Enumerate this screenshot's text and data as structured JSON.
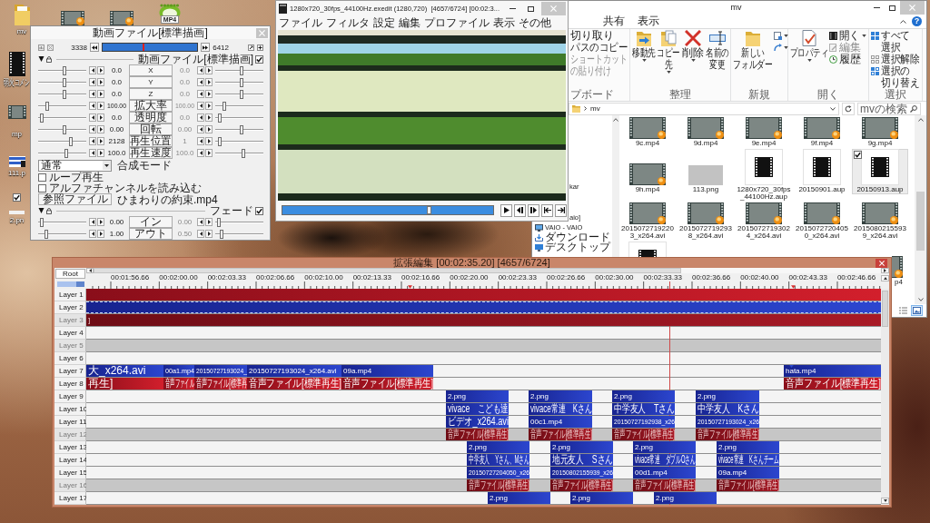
{
  "desktop": {
    "icons": [
      {
        "kind": "folder",
        "label": "mv",
        "selected": false
      },
      {
        "kind": "video",
        "selected": false
      },
      {
        "kind": "video",
        "selected": false
      },
      {
        "kind": "mp4",
        "badge": "MP4",
        "selected": false
      },
      {
        "kind": "film",
        "label": "弱火コメン",
        "selected": false
      },
      {
        "kind": "clip",
        "label": "mp",
        "selected": false
      },
      {
        "kind": "image",
        "label": "111.p",
        "selected": false
      },
      {
        "kind": "blank",
        "label": "2.pn",
        "selected": true
      }
    ]
  },
  "object_dialog": {
    "title": "動画ファイル[標準描画]",
    "frame_range": {
      "start": "3338",
      "end": "6412",
      "level": 0.43
    },
    "object": {
      "label": "動画ファイル[標準描画]",
      "expanded": true,
      "checked": true
    },
    "params": [
      {
        "name": "X",
        "start": {
          "value": "0.0",
          "level": 0.55
        },
        "end": {
          "value": "0.0",
          "disabled": true,
          "level": 0.55
        }
      },
      {
        "name": "Y",
        "start": {
          "value": "0.0",
          "level": 0.55
        },
        "end": {
          "value": "0.0",
          "disabled": true,
          "level": 0.55
        }
      },
      {
        "name": "Z",
        "start": {
          "value": "0.0",
          "level": 0.55
        },
        "end": {
          "value": "0.0",
          "disabled": true,
          "level": 0.55
        }
      },
      {
        "name": "拡大率",
        "start": {
          "value": "100.00",
          "level": 0.17
        },
        "end": {
          "value": "100.00",
          "disabled": true,
          "level": 0.16
        }
      },
      {
        "name": "透明度",
        "start": {
          "value": "0.0",
          "level": 0.04
        },
        "end": {
          "value": "0.0",
          "disabled": true,
          "level": 0.06
        }
      },
      {
        "name": "回転",
        "start": {
          "value": "0.00",
          "level": 0.55
        },
        "end": {
          "value": "0.00",
          "disabled": true,
          "level": 0.55
        }
      },
      {
        "name": "再生位置",
        "start": {
          "value": "2128",
          "level": 0.7
        },
        "end": {
          "value": "1",
          "disabled": true,
          "level": 0.06
        }
      },
      {
        "name": "再生速度",
        "start": {
          "value": "100.0",
          "level": 0.6
        },
        "end": {
          "value": "100.0",
          "disabled": true,
          "level": 0.6
        }
      }
    ],
    "blend_mode": {
      "value": "通常",
      "label": "合成モード"
    },
    "options": [
      {
        "label": "ループ再生",
        "checked": false
      },
      {
        "label": "アルファチャンネルを読み込む",
        "checked": false
      }
    ],
    "file": {
      "button": "参照ファイル",
      "name": "ひまわりの約束.mp4"
    },
    "filter": {
      "label": "フェード",
      "expanded": true,
      "checked": true,
      "params": [
        {
          "name": "イン",
          "start": {
            "value": "0.00",
            "level": 0.04
          },
          "end": {
            "value": "0.00",
            "disabled": true,
            "level": 0.05
          }
        },
        {
          "name": "アウト",
          "start": {
            "value": "1.00",
            "level": 0.15
          },
          "end": {
            "value": "0.50",
            "disabled": true,
            "level": 0.1
          }
        }
      ]
    }
  },
  "preview": {
    "title": "1280x720_30fps_44100Hz.exedit (1280,720)  [4657/6724] [00:02:3...",
    "menu": [
      "ファイル",
      "フィルタ",
      "設定",
      "編集",
      "プロファイル",
      "表示",
      "その他"
    ],
    "seek": {
      "level": 0.7
    }
  },
  "explorer": {
    "title": "mv",
    "tabs": [
      {
        "label": "共有",
        "selected": false
      },
      {
        "label": "表示",
        "selected": false
      }
    ],
    "help_button": "?",
    "ribbon": [
      {
        "label": "プボード",
        "items": [
          {
            "kind": "small",
            "label": "切り取り",
            "dropdown": false,
            "disabled": false
          },
          {
            "kind": "small",
            "label": "パスのコピー",
            "dropdown": false,
            "disabled": false
          },
          {
            "kind": "small",
            "label": "ショートカットの貼り付け",
            "dropdown": false,
            "disabled": true
          }
        ]
      },
      {
        "label": "整理",
        "items": [
          {
            "kind": "large",
            "label": "移動先",
            "dropdown": true,
            "disabled": false
          },
          {
            "kind": "large",
            "label": "コピー先",
            "dropdown": true,
            "disabled": false
          },
          {
            "kind": "large",
            "label": "削除",
            "dropdown": true,
            "disabled": false
          },
          {
            "kind": "large",
            "label": "名前の変更",
            "dropdown": false,
            "disabled": false
          }
        ]
      },
      {
        "label": "新規",
        "items": [
          {
            "kind": "large",
            "label": "新しいフォルダー",
            "dropdown": false,
            "disabled": false
          },
          {
            "kind": "small",
            "dropdown": true,
            "disabled": false
          },
          {
            "kind": "small",
            "dropdown": true,
            "disabled": false
          }
        ]
      },
      {
        "label": "開く",
        "items": [
          {
            "kind": "large",
            "label": "プロパティ",
            "dropdown": true,
            "disabled": false
          },
          {
            "kind": "small",
            "label": "開く",
            "dropdown": true,
            "disabled": false
          },
          {
            "kind": "small",
            "label": "編集",
            "dropdown": false,
            "disabled": true
          },
          {
            "kind": "small",
            "label": "履歴",
            "dropdown": false,
            "disabled": false
          }
        ]
      },
      {
        "label": "選択",
        "items": [
          {
            "kind": "small",
            "label": "すべて選択",
            "dropdown": false,
            "disabled": false
          },
          {
            "kind": "small",
            "label": "選択解除",
            "dropdown": false,
            "disabled": false
          },
          {
            "kind": "small",
            "label": "選択の切り替え",
            "dropdown": false,
            "disabled": false
          }
        ]
      }
    ],
    "address": {
      "segments": [
        "mv"
      ]
    },
    "search": {
      "placeholder": "mvの検索"
    },
    "nav": [
      {
        "label": "kar"
      },
      {
        "label": "aio]"
      },
      {
        "label": "VAIO - VAIO"
      },
      {
        "label": "ダウンロード"
      },
      {
        "label": "デスクトップ"
      }
    ],
    "files": [
      {
        "name": "9c.mp4",
        "kind": "video",
        "selected": false
      },
      {
        "name": "9d.mp4",
        "kind": "video",
        "selected": false
      },
      {
        "name": "9e.mp4",
        "kind": "video",
        "selected": false
      },
      {
        "name": "9f.mp4",
        "kind": "video",
        "selected": false
      },
      {
        "name": "9g.mp4",
        "kind": "video",
        "selected": false
      },
      {
        "name": "9h.mp4",
        "kind": "video",
        "selected": false
      },
      {
        "name": "113.png",
        "kind": "image",
        "selected": false
      },
      {
        "name": "1280x720_30fps_44100Hz.aup",
        "kind": "project",
        "selected": false
      },
      {
        "name": "20150901.aup",
        "kind": "project",
        "selected": false
      },
      {
        "name": "20150913.aup",
        "kind": "project",
        "selected": true
      },
      {
        "name": "20150727192203_x264.avi",
        "kind": "video",
        "selected": false
      },
      {
        "name": "20150727192938_x264.avi",
        "kind": "video",
        "selected": false
      },
      {
        "name": "20150727193024_x264.avi",
        "kind": "video",
        "selected": false
      },
      {
        "name": "20150727204050_x264.avi",
        "kind": "video",
        "selected": false
      },
      {
        "name": "20150802155939_x264.avi",
        "kind": "video",
        "selected": false
      },
      {
        "kind": "project",
        "selected": false
      },
      {
        "name": "p4",
        "kind": "video",
        "selected": false
      }
    ],
    "view_buttons": [
      {
        "selected": false
      },
      {
        "selected": true
      }
    ]
  },
  "timeline": {
    "title": "拡張編集 [00:02:35.20] [4657/6724]",
    "root": "Root",
    "zoom": {
      "level": 0.72
    },
    "ticks": [
      "00:01:56.66",
      "00:02:00.00",
      "00:02:03.33",
      "00:02:06.66",
      "00:02:10.00",
      "00:02:13.33",
      "00:02:16.66",
      "00:02:20.00",
      "00:02:23.33",
      "00:02:26.66",
      "00:02:30.00",
      "00:02:33.33",
      "00:02:36.66",
      "00:02:40.00",
      "00:02:43.33",
      "00:02:46.66"
    ],
    "layers": [
      {
        "name": "Layer 1",
        "on": true,
        "clips": [
          {
            "kind": "audio",
            "selected": false
          }
        ]
      },
      {
        "name": "Layer 2",
        "on": true,
        "clips": [
          {
            "kind": "video",
            "selected": true
          }
        ]
      },
      {
        "name": "Layer 3",
        "on": false,
        "clips": [
          {
            "kind": "audio",
            "text": "]",
            "selected": false
          }
        ]
      },
      {
        "name": "Layer 4",
        "on": true
      },
      {
        "name": "Layer 5",
        "on": false
      },
      {
        "name": "Layer 6",
        "on": true
      },
      {
        "name": "Layer 7",
        "on": true,
        "clips": [
          {
            "kind": "video",
            "text": "大_x264.avi",
            "selected": false
          },
          {
            "kind": "video",
            "text": "00a1.mp4",
            "selected": false
          },
          {
            "kind": "video",
            "text": "20150727193024_",
            "selected": false
          },
          {
            "kind": "video",
            "text": "20150727193024_x264.avi",
            "selected": false
          },
          {
            "kind": "video",
            "text": "09a.mp4",
            "selected": false
          },
          {
            "kind": "video",
            "text": "hata.mp4",
            "selected": false
          }
        ]
      },
      {
        "name": "Layer 8",
        "on": true,
        "clips": [
          {
            "kind": "audio",
            "text": "再生]",
            "selected": false
          },
          {
            "kind": "audio",
            "text": "音声ファイル",
            "selected": false
          },
          {
            "kind": "audio",
            "text": "音声ファイル[標準再",
            "selected": false
          },
          {
            "kind": "audio",
            "text": "音声ファイル[標準再生]",
            "selected": false
          },
          {
            "kind": "audio",
            "text": "音声ファイル[標準再生]",
            "selected": false
          },
          {
            "kind": "audio",
            "text": "音声ファイル[標準再生]",
            "selected": false
          }
        ]
      },
      {
        "name": "Layer 9",
        "on": true,
        "clips": [
          {
            "kind": "video",
            "text": "2.png",
            "selected": false
          },
          {
            "kind": "video",
            "text": "2.png",
            "selected": false
          },
          {
            "kind": "video",
            "text": "2.png",
            "selected": false
          },
          {
            "kind": "video",
            "text": "2.png",
            "selected": false
          }
        ]
      },
      {
        "name": "Layer 10",
        "on": true,
        "clips": [
          {
            "kind": "video",
            "text": "vivace　こども達",
            "selected": false
          },
          {
            "kind": "video",
            "text": "vivace常連　Kさん",
            "selected": false
          },
          {
            "kind": "video",
            "text": "中学友人　Tさん",
            "selected": false
          },
          {
            "kind": "video",
            "text": "中学友人　Kさん",
            "selected": false
          }
        ]
      },
      {
        "name": "Layer 11",
        "on": true,
        "clips": [
          {
            "kind": "video",
            "text": "ビデオ_x264.avi",
            "selected": false
          },
          {
            "kind": "video",
            "text": "00c1.mp4",
            "selected": false
          },
          {
            "kind": "video",
            "text": "20150727192938_x26",
            "selected": false
          },
          {
            "kind": "video",
            "text": "20150727193024_x26",
            "selected": false
          }
        ]
      },
      {
        "name": "Layer 12",
        "on": false,
        "clips": [
          {
            "kind": "audio",
            "text": "音声ファイル[標準再生]",
            "selected": false
          },
          {
            "kind": "audio",
            "text": "音声ファイル[標準再生]",
            "selected": false
          },
          {
            "kind": "audio",
            "text": "音声ファイル[標準再生]",
            "selected": false
          },
          {
            "kind": "audio",
            "text": "音声ファイル[標準再生]",
            "selected": false
          }
        ]
      },
      {
        "name": "Layer 13",
        "on": true,
        "clips": [
          {
            "kind": "video",
            "text": "2.png",
            "selected": false
          },
          {
            "kind": "video",
            "text": "2.png",
            "selected": false
          },
          {
            "kind": "video",
            "text": "2.png",
            "selected": false
          },
          {
            "kind": "video",
            "text": "2.png",
            "selected": false
          }
        ]
      },
      {
        "name": "Layer 14",
        "on": true,
        "clips": [
          {
            "kind": "video",
            "text": "中学友人　Yさん、Mさん",
            "selected": false
          },
          {
            "kind": "video",
            "text": "地元友人　Sさん",
            "selected": false
          },
          {
            "kind": "video",
            "text": "vivace常連　ダブルOさん",
            "selected": false
          },
          {
            "kind": "video",
            "text": "vivace常連　Kさんチーム",
            "selected": false
          }
        ]
      },
      {
        "name": "Layer 15",
        "on": true,
        "clips": [
          {
            "kind": "video",
            "text": "20150727204050_x26",
            "selected": false
          },
          {
            "kind": "video",
            "text": "20150802155939_x26",
            "selected": false
          },
          {
            "kind": "video",
            "text": "00d1.mp4",
            "selected": false
          },
          {
            "kind": "video",
            "text": "09a.mp4",
            "selected": false
          }
        ]
      },
      {
        "name": "Layer 16",
        "on": false,
        "clips": [
          {
            "kind": "audio",
            "text": "音声ファイル[標準再生]",
            "selected": false
          },
          {
            "kind": "audio",
            "text": "音声ファイル[標準再生]",
            "selected": false
          },
          {
            "kind": "audio",
            "text": "音声ファイル[標準再生]",
            "selected": false
          },
          {
            "kind": "audio",
            "text": "音声ファイル[標準再生]",
            "selected": false
          }
        ]
      },
      {
        "name": "Layer 17",
        "on": true,
        "clips": [
          {
            "kind": "video",
            "text": "2.png",
            "selected": false
          },
          {
            "kind": "video",
            "text": "2.png",
            "selected": false
          },
          {
            "kind": "video",
            "text": "2.png",
            "selected": false
          }
        ]
      }
    ]
  }
}
